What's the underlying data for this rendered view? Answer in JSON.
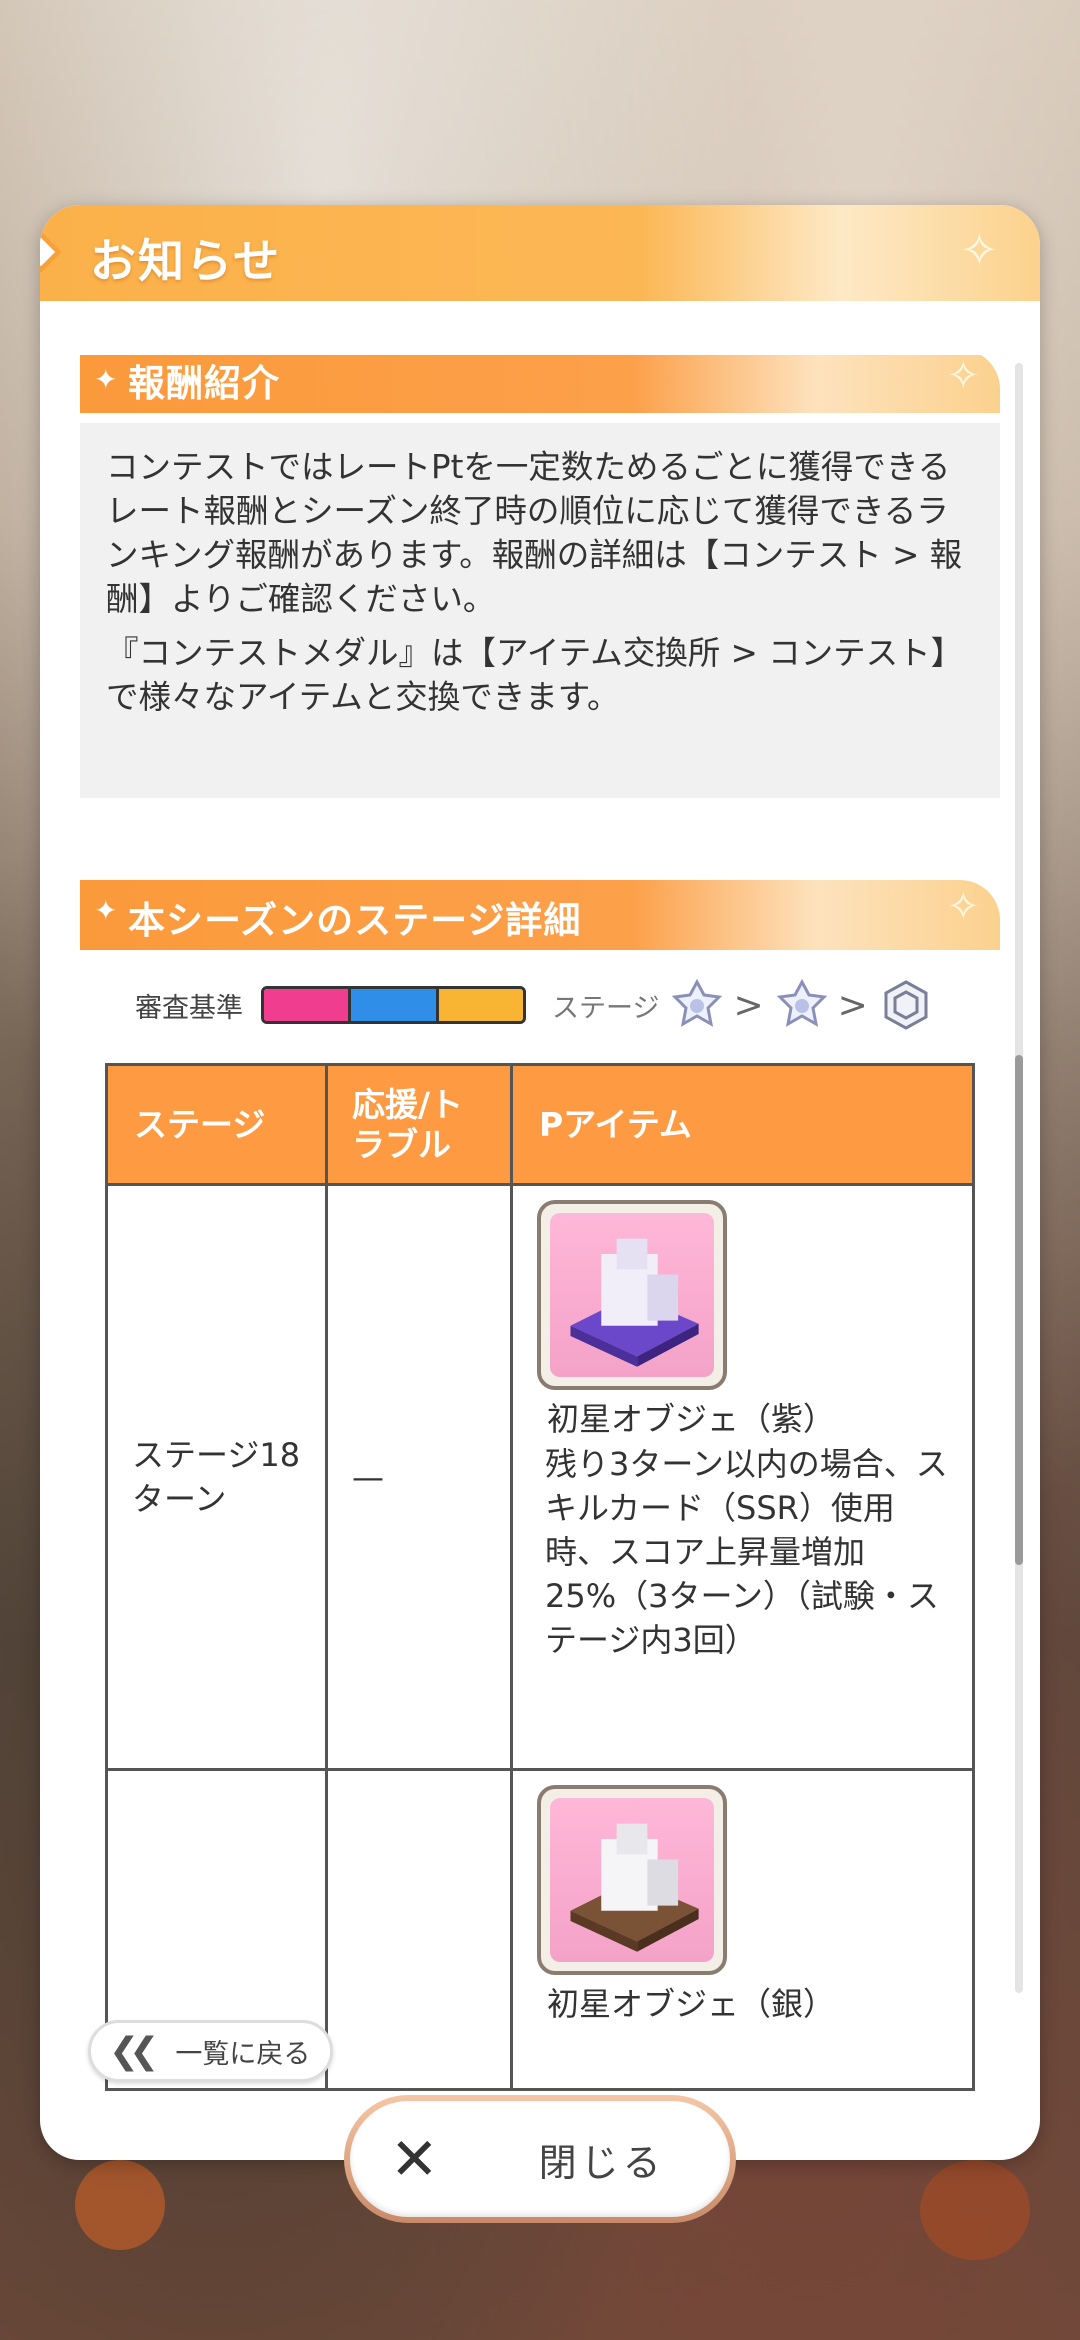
{
  "dialog": {
    "title": "お知らせ"
  },
  "reward_section": {
    "title": "報酬紹介",
    "paragraphs": [
      "コンテストではレートPtを一定数ためるごとに獲得できるレート報酬とシーズン終了時の順位に応じて獲得できるランキング報酬があります。報酬の詳細は【コンテスト > 報酬】よりご確認ください。",
      "『コンテストメダル』は【アイテム交換所 > コンテスト】で様々なアイテムと交換できます。"
    ]
  },
  "stage_section": {
    "title": "本シーズンのステージ詳細",
    "criteria_label": "審査基準",
    "criteria_colors": [
      "#f03d8f",
      "#2f8fe8",
      "#f7b533"
    ],
    "stage_label": "ステージ",
    "arrow": ">"
  },
  "table": {
    "headers": [
      "ステージ",
      "応援/トラブル",
      "Pアイテム"
    ],
    "rows": [
      {
        "stage": "ステージ18ターン",
        "support": "—",
        "item_name": "初星オブジェ（紫）",
        "item_desc": "残り3ターン以内の場合、スキルカード（SSR）使用時、スコア上昇量増加25%（3ターン）（試験・ステージ内3回）"
      },
      {
        "stage": "",
        "support": "",
        "item_name": "初星オブジェ（銀）",
        "item_desc": ""
      }
    ]
  },
  "footer": {
    "back_label": "一覧に戻る",
    "close_label": "閉じる"
  }
}
